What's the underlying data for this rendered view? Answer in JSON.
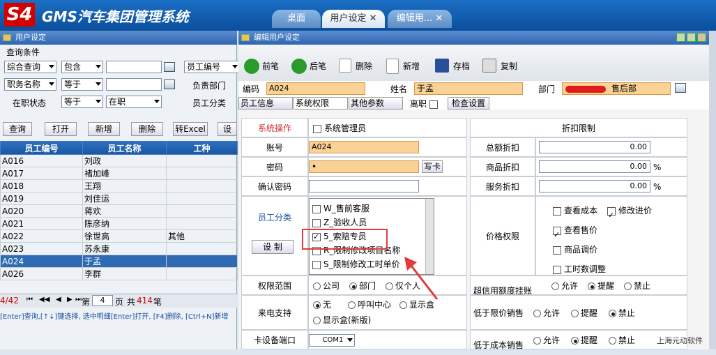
{
  "app": {
    "logo": "S4",
    "title": "GMS汽车集团管理系统"
  },
  "tabs": [
    {
      "label": "桌面"
    },
    {
      "label": "用户设定"
    },
    {
      "label": "编辑用..."
    }
  ],
  "left": {
    "title": "用户设定",
    "query_title": "查询条件",
    "row1": {
      "field": "综合查询",
      "op": "包含",
      "value": "",
      "right": "员工编号"
    },
    "row2": {
      "field": "职务名称",
      "op": "等于",
      "value": "",
      "right": "负责部门"
    },
    "row3": {
      "label": "在职状态",
      "op": "等于",
      "value": "在职",
      "right": "员工分类"
    },
    "buttons": {
      "query": "查询",
      "open": "打开",
      "add": "新增",
      "delete": "删除",
      "excel": "转Excel",
      "set": "设"
    },
    "columns": [
      "员工编号",
      "员工名称",
      "工种"
    ],
    "rows": [
      [
        "A016",
        "刘政",
        ""
      ],
      [
        "A017",
        "褚加峰",
        ""
      ],
      [
        "A018",
        "王翔",
        ""
      ],
      [
        "A019",
        "刘佳运",
        ""
      ],
      [
        "A020",
        "蒋欢",
        ""
      ],
      [
        "A021",
        "陈彦纳",
        ""
      ],
      [
        "A022",
        "徐世高",
        "其他"
      ],
      [
        "A023",
        "苏永康",
        ""
      ],
      [
        "A024",
        "于孟",
        ""
      ],
      [
        "A026",
        "李群",
        ""
      ]
    ],
    "pager": {
      "pos": "4/42",
      "first": "⏮",
      "prev": "◀◀",
      "back": "◀",
      "next": "▶",
      "last": "⏭",
      "page_prefix": "第",
      "page": "4",
      "page_suffix": "页",
      "total_prefix": "共",
      "total": "414",
      "total_suffix": "笔"
    },
    "hint": "[Enter]查询,[↑↓]键选择, 选中明细[Enter]打开, [F4]删除, [Ctrl+N]新增"
  },
  "right": {
    "title": "编辑用户设定",
    "toolbar": {
      "prev": "前笔",
      "next": "后笔",
      "delete": "删除",
      "add": "新增",
      "save": "存档",
      "copy": "复制"
    },
    "code_label": "编码",
    "code": "A024",
    "name_label": "姓名",
    "name": "于孟",
    "dept_label": "部门",
    "dept": "售后部",
    "subtabs": {
      "info": "员工信息",
      "perm": "系统权限",
      "other": "其他参数",
      "leave": "离职",
      "check": "检查设置"
    },
    "sys_op": "系统操作",
    "sys_admin": "系统管理员",
    "account_label": "账号",
    "account": "A024",
    "pwd_label": "密码",
    "pwd": "•",
    "write_card": "写卡",
    "confirm_pwd": "确认密码",
    "emp_cat": "员工分类",
    "setup": "设 制",
    "cat_items": [
      {
        "label": "W_售前客服",
        "on": false
      },
      {
        "label": "Z_验收人员",
        "on": false
      },
      {
        "label": "5_索赔专员",
        "on": true
      },
      {
        "label": "R_限制修改项目名称",
        "on": false
      },
      {
        "label": "S_限制修改工时单价",
        "on": false
      }
    ],
    "discount_title": "折扣限制",
    "total_disc": "总额折扣",
    "total_disc_val": "0.00",
    "goods_disc": "商品折扣",
    "goods_disc_val": "0.00",
    "pct": "%",
    "service_disc": "服务折扣",
    "service_disc_val": "0.00",
    "price_perm": "价格权限",
    "price_items": {
      "view_cost": "查看成本",
      "mod_price": "修改进价",
      "view_sale": "查看售价",
      "goods_adj": "商品调价",
      "hours_adj": "工时数调整"
    },
    "scope_label": "权限范围",
    "scope_opts": [
      "公司",
      "部门",
      "仅个人"
    ],
    "credit_label": "超信用额度挂账",
    "opts3": [
      "允许",
      "提醒",
      "禁止"
    ],
    "caller_label": "来电支持",
    "caller_opts": [
      "无",
      "呼叫中心",
      "显示盒",
      "显示盒(新版)"
    ],
    "below_limit": "低于限价销售",
    "card_port": "卡设备端口",
    "port": "COM1",
    "below_cost": "低于成本销售",
    "watermark": "上海元动软件"
  },
  "colors": {
    "accent": "#1a56a3",
    "highlight": "#e23b3b",
    "orange_field": "#fbd295"
  }
}
